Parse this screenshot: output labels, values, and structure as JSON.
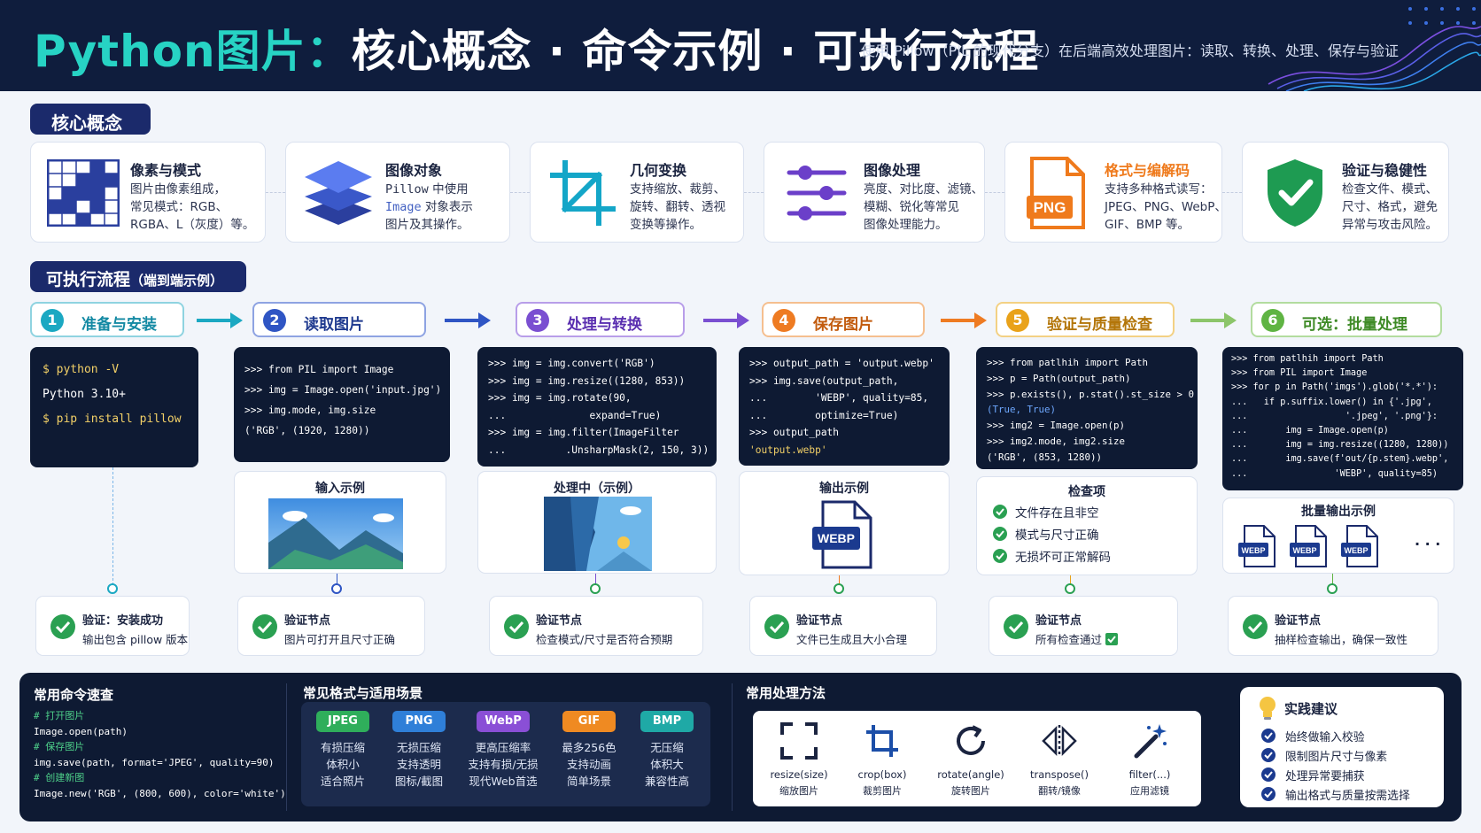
{
  "header": {
    "title_accent": "Python图片：",
    "title_rest": "核心概念 · 命令示例 · 可执行流程",
    "subtitle": "使用 Pillow（PIL 的现代分支）在后端高效处理图片：读取、转换、处理、保存与验证"
  },
  "concepts_section": {
    "label": "核心概念"
  },
  "concepts": [
    {
      "title": "像素与模式",
      "desc": "图片由像素组成，\n常见模式：RGB、\nRGBA、L（灰度）等。",
      "icon": "pixel-grid-icon"
    },
    {
      "title": "图像对象",
      "desc_l1_a": "Pillow",
      "desc_l1_b": " 中使用",
      "desc_l2_a": "Image",
      "desc_l2_b": " 对象表示",
      "desc_l3": "图片及其操作。",
      "icon": "layers-icon"
    },
    {
      "title": "几何变换",
      "desc": "支持缩放、裁剪、\n旋转、翻转、透视\n变换等操作。",
      "icon": "crop-icon"
    },
    {
      "title": "图像处理",
      "desc": "亮度、对比度、滤镜、\n模糊、锐化等常见\n图像处理能力。",
      "icon": "sliders-icon"
    },
    {
      "title": "格式与编解码",
      "desc": "支持多种格式读写：\nJPEG、PNG、WebP、\nGIF、BMP 等。",
      "icon": "png-file-icon",
      "icon_label": "PNG"
    },
    {
      "title": "验证与稳健性",
      "desc": "检查文件、模式、\n尺寸、格式，避免\n异常与攻击风险。",
      "icon": "shield-check-icon"
    }
  ],
  "flow_section": {
    "label": "可执行流程",
    "label_small": "（端到端示例）"
  },
  "steps": [
    {
      "num": "1",
      "label": "准备与安装",
      "color": "#1ba8c2"
    },
    {
      "num": "2",
      "label": "读取图片",
      "color": "#2f55c4"
    },
    {
      "num": "3",
      "label": "处理与转换",
      "color": "#7a4fd1"
    },
    {
      "num": "4",
      "label": "保存图片",
      "color": "#ee7b22"
    },
    {
      "num": "5",
      "label": "验证与质量检查",
      "color": "#e9a21a"
    },
    {
      "num": "6",
      "label": "可选：批量处理",
      "color": "#5fb443"
    }
  ],
  "code": {
    "s1": [
      "$ python -V",
      "Python 3.10+",
      "$ pip install pillow"
    ],
    "s2": [
      ">>> from PIL import Image",
      ">>> img = Image.open('input.jpg')",
      ">>> img.mode, img.size",
      "('RGB', (1920, 1280))"
    ],
    "s3": [
      ">>> img = img.convert('RGB')",
      ">>> img = img.resize((1280, 853))",
      ">>> img = img.rotate(90,",
      "...              expand=True)",
      ">>> img = img.filter(ImageFilter",
      "...          .UnsharpMask(2, 150, 3))"
    ],
    "s4": [
      ">>> output_path = 'output.webp'",
      ">>> img.save(output_path,",
      "...        'WEBP', quality=85,",
      "...        optimize=True)",
      ">>> output_path",
      "'output.webp'"
    ],
    "s5": [
      ">>> from patlhih import Path",
      ">>> p = Path(output_path)",
      ">>> p.exists(), p.stat().st_size > 0",
      "(True, True)",
      ">>> img2 = Image.open(p)",
      ">>> img2.mode, img2.size",
      "('RGB', (853, 1280))"
    ],
    "s6": [
      ">>> from patlhih import Path",
      ">>> from PIL import Image",
      ">>> for p in Path('imgs').glob('*.*'):",
      "...   if p.suffix.lower() in {'.jpg',",
      "...                  '.jpeg', '.png'}:",
      "...       img = Image.open(p)",
      "...       img = img.resize((1280, 1280))",
      "...       img.save(f'out/{p.stem}.webp',",
      "...                'WEBP', quality=85)"
    ]
  },
  "panels": {
    "input": "输入示例",
    "processing": "处理中（示例）",
    "output": "输出示例",
    "output_badge": "WEBP",
    "checks_title": "检查项",
    "checks": [
      "文件存在且非空",
      "模式与尺寸正确",
      "无损坏可正常解码"
    ],
    "batch": "批量输出示例",
    "batch_badge": "WEBP",
    "batch_more": "· · ·"
  },
  "verify": [
    {
      "title": "验证：安装成功",
      "desc": "输出包含 pillow 版本"
    },
    {
      "title": "验证节点",
      "desc": "图片可打开且尺寸正确"
    },
    {
      "title": "验证节点",
      "desc": "检查模式/尺寸是否符合预期"
    },
    {
      "title": "验证节点",
      "desc": "文件已生成且大小合理"
    },
    {
      "title": "验证节点",
      "desc": "所有检查通过"
    },
    {
      "title": "验证节点",
      "desc": "抽样检查输出，确保一致性"
    }
  ],
  "cheatsheet": {
    "title": "常用命令速查",
    "lines": [
      "# 打开图片",
      "Image.open(path)",
      "# 保存图片",
      "img.save(path, format='JPEG', quality=90)",
      "# 创建新图",
      "Image.new('RGB', (800, 600), color='white')"
    ]
  },
  "formats": {
    "title": "常见格式与适用场景",
    "items": [
      {
        "name": "JPEG",
        "desc": "有损压缩\n体积小\n适合照片",
        "color": "#2fae5b"
      },
      {
        "name": "PNG",
        "desc": "无损压缩\n支持透明\n图标/截图",
        "color": "#2f7fd8"
      },
      {
        "name": "WebP",
        "desc": "更高压缩率\n支持有损/无损\n现代Web首选",
        "color": "#8a4fd6"
      },
      {
        "name": "GIF",
        "desc": "最多256色\n支持动画\n简单场景",
        "color": "#ef8a22"
      },
      {
        "name": "BMP",
        "desc": "无压缩\n体积大\n兼容性高",
        "color": "#1fa9a6"
      }
    ]
  },
  "methods": {
    "title": "常用处理方法",
    "items": [
      {
        "name": "resize(size)",
        "cn": "缩放图片",
        "icon": "resize-icon"
      },
      {
        "name": "crop(box)",
        "cn": "裁剪图片",
        "icon": "crop-icon"
      },
      {
        "name": "rotate(angle)",
        "cn": "旋转图片",
        "icon": "rotate-icon"
      },
      {
        "name": "transpose()",
        "cn": "翻转/镜像",
        "icon": "flip-icon"
      },
      {
        "name": "filter(...)",
        "cn": "应用滤镜",
        "icon": "magic-wand-icon"
      }
    ]
  },
  "tips": {
    "title": "实践建议",
    "items": [
      "始终做输入校验",
      "限制图片尺寸与像素",
      "处理异常要捕获",
      "输出格式与质量按需选择"
    ]
  }
}
